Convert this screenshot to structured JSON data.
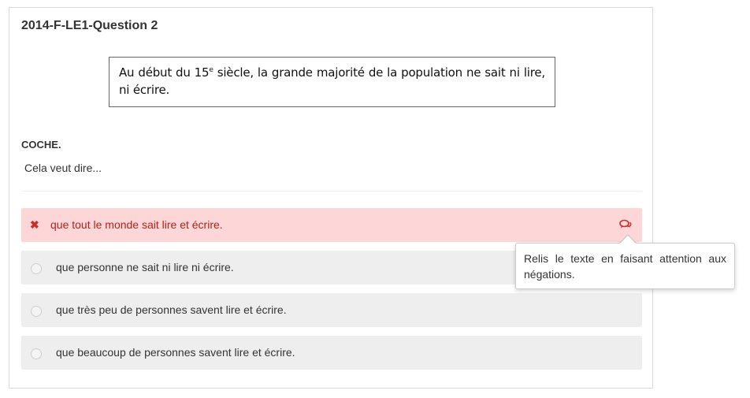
{
  "question": {
    "title": "2014-F-LE1-Question 2",
    "passage_before": "Au début du 15",
    "passage_sup": "e",
    "passage_after": " siècle, la grande majorité de la population ne sait ni lire, ni écrire.",
    "instruction": "COCHE.",
    "stem": "Cela veut dire..."
  },
  "options": [
    {
      "label": "que tout le monde sait lire et écrire.",
      "state": "wrong"
    },
    {
      "label": "que personne ne sait ni lire ni écrire.",
      "state": "unselected"
    },
    {
      "label": "que très peu de personnes savent lire et écrire.",
      "state": "unselected"
    },
    {
      "label": "que beaucoup de personnes savent lire et écrire.",
      "state": "unselected"
    }
  ],
  "tooltip": {
    "text": "Relis le texte en faisant attention aux négations."
  },
  "icons": {
    "wrong": "close-icon",
    "feedback": "comments-icon"
  },
  "colors": {
    "wrong_background": "#fdd7d7",
    "wrong_text": "#b3221c",
    "option_background": "#eeeeee"
  }
}
